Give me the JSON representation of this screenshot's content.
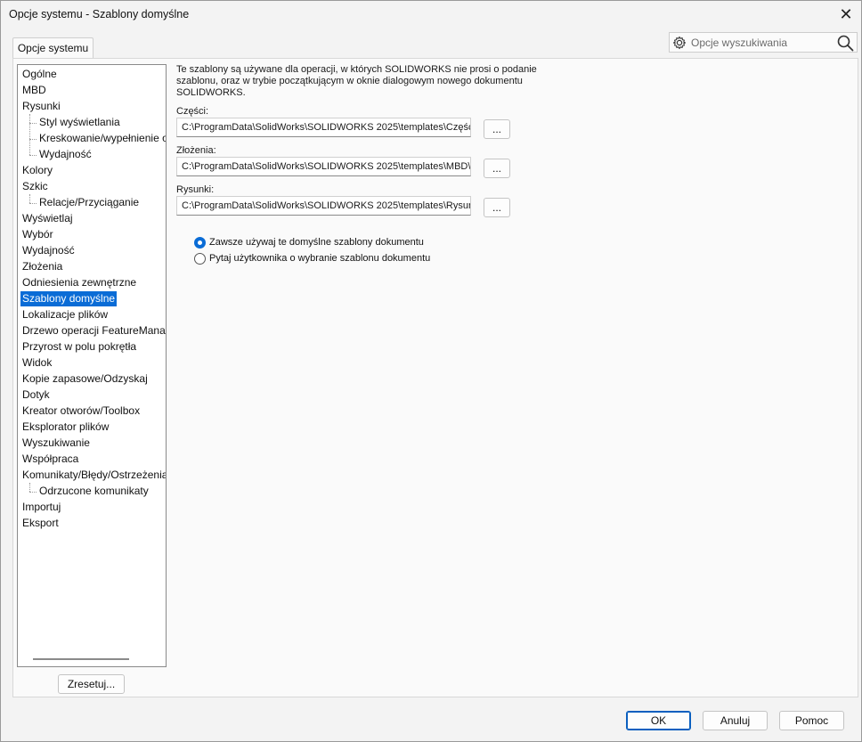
{
  "window": {
    "title": "Opcje systemu - Szablony domyślne",
    "close_glyph": "✕"
  },
  "tab": {
    "label": "Opcje systemu"
  },
  "search": {
    "placeholder": "Opcje wyszukiwania",
    "icon_left": "gear-icon",
    "icon_right": "search-icon"
  },
  "tree": {
    "items": [
      {
        "label": "Ogólne",
        "level": 0
      },
      {
        "label": "MBD",
        "level": 0
      },
      {
        "label": "Rysunki",
        "level": 0
      },
      {
        "label": "Styl wyświetlania",
        "level": 1
      },
      {
        "label": "Kreskowanie/wypełnienie obszaru",
        "level": 1
      },
      {
        "label": "Wydajność",
        "level": 1
      },
      {
        "label": "Kolory",
        "level": 0
      },
      {
        "label": "Szkic",
        "level": 0
      },
      {
        "label": "Relacje/Przyciąganie",
        "level": 1
      },
      {
        "label": "Wyświetlaj",
        "level": 0
      },
      {
        "label": "Wybór",
        "level": 0
      },
      {
        "label": "Wydajność",
        "level": 0
      },
      {
        "label": "Złożenia",
        "level": 0
      },
      {
        "label": "Odniesienia zewnętrzne",
        "level": 0
      },
      {
        "label": "Szablony domyślne",
        "level": 0,
        "selected": true
      },
      {
        "label": "Lokalizacje plików",
        "level": 0
      },
      {
        "label": "Drzewo operacji FeatureManager",
        "level": 0
      },
      {
        "label": "Przyrost w polu pokrętła",
        "level": 0
      },
      {
        "label": "Widok",
        "level": 0
      },
      {
        "label": "Kopie zapasowe/Odzyskaj",
        "level": 0
      },
      {
        "label": "Dotyk",
        "level": 0
      },
      {
        "label": "Kreator otworów/Toolbox",
        "level": 0
      },
      {
        "label": "Eksplorator plików",
        "level": 0
      },
      {
        "label": "Wyszukiwanie",
        "level": 0
      },
      {
        "label": "Współpraca",
        "level": 0
      },
      {
        "label": "Komunikaty/Błędy/Ostrzeżenia",
        "level": 0
      },
      {
        "label": "Odrzucone komunikaty",
        "level": 1
      },
      {
        "label": "Importuj",
        "level": 0
      },
      {
        "label": "Eksport",
        "level": 0
      }
    ]
  },
  "reset_button": "Zresetuj...",
  "content": {
    "description": "Te szablony są używane dla operacji, w których SOLIDWORKS nie prosi o podanie szablonu, oraz w trybie początkującym w oknie dialogowym nowego dokumentu SOLIDWORKS.",
    "parts": {
      "label": "Części:",
      "value": "C:\\ProgramData\\SolidWorks\\SOLIDWORKS 2025\\templates\\Część.prtdot",
      "browse": "..."
    },
    "assemblies": {
      "label": "Złożenia:",
      "value": "C:\\ProgramData\\SolidWorks\\SOLIDWORKS 2025\\templates\\MBD\\Złożenie.asmdot",
      "browse": "..."
    },
    "drawings": {
      "label": "Rysunki:",
      "value": "C:\\ProgramData\\SolidWorks\\SOLIDWORKS 2025\\templates\\Rysunek.drwdot",
      "browse": "..."
    },
    "radio_always": "Zawsze używaj te domyślne szablony dokumentu",
    "radio_ask": "Pytaj użytkownika o wybranie szablonu dokumentu",
    "selected_option": "always"
  },
  "footer": {
    "ok": "OK",
    "cancel": "Anuluj",
    "help": "Pomoc"
  },
  "colors": {
    "accent": "#0a6cd6",
    "background": "#f3f3f3",
    "panel": "#fafafa"
  }
}
